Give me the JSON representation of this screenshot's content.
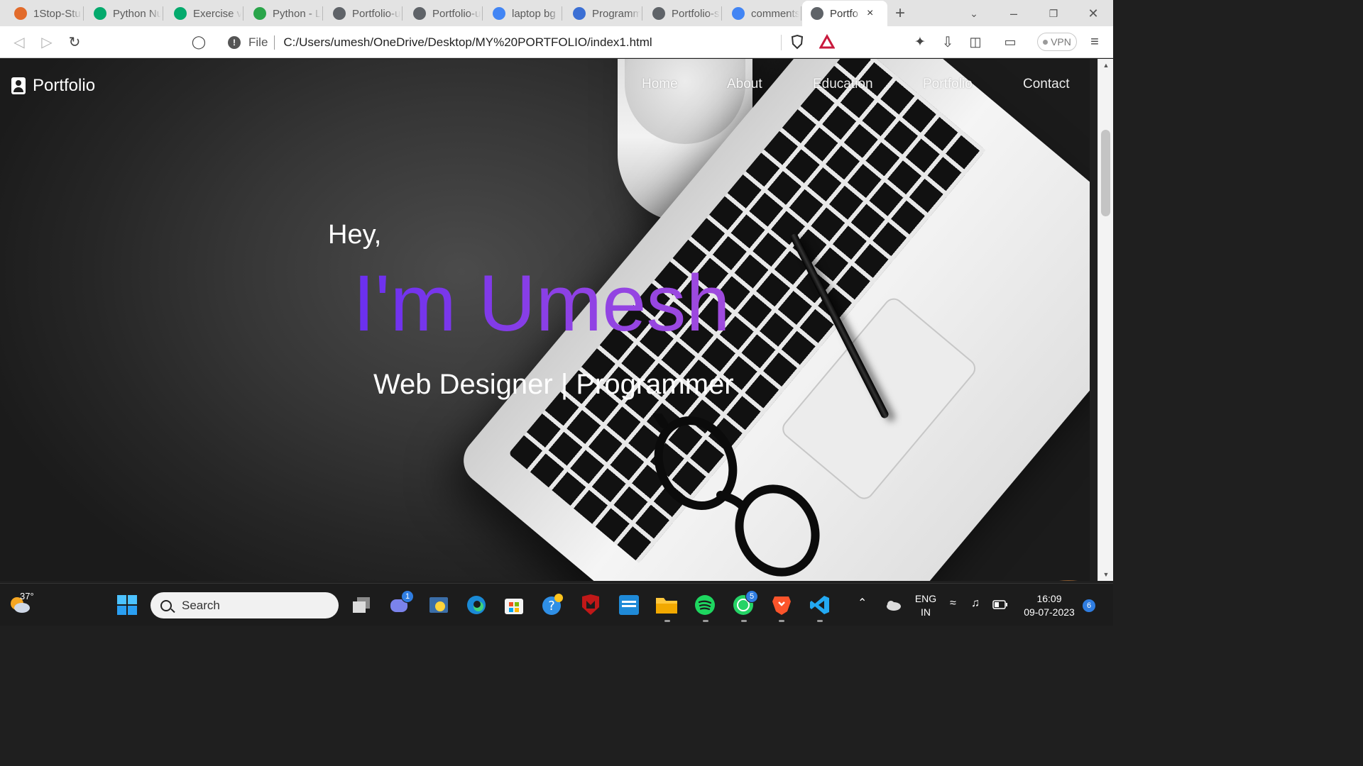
{
  "browser": {
    "tabs": [
      {
        "title": "1Stop-Stu",
        "favicon": "1stop-logo",
        "color": "#e26b2b"
      },
      {
        "title": "Python Nu",
        "favicon": "w3schools-logo",
        "color": "#04aa6d"
      },
      {
        "title": "Exercise v",
        "favicon": "w3schools-logo",
        "color": "#04aa6d"
      },
      {
        "title": "Python - L",
        "favicon": "freecodecamp-logo",
        "color": "#2aa54a"
      },
      {
        "title": "Portfolio-u",
        "favicon": "globe-icon",
        "color": "#5f6368"
      },
      {
        "title": "Portfolio-u",
        "favicon": "globe-icon",
        "color": "#5f6368"
      },
      {
        "title": "laptop bg",
        "favicon": "google-logo",
        "color": "#4285f4"
      },
      {
        "title": "Programm",
        "favicon": "programiz-logo",
        "color": "#3b6fd4"
      },
      {
        "title": "Portfolio-s",
        "favicon": "globe-icon",
        "color": "#5f6368"
      },
      {
        "title": "comments",
        "favicon": "google-logo",
        "color": "#4285f4"
      },
      {
        "title": "Portfo",
        "favicon": "globe-icon",
        "color": "#5f6368",
        "active": true
      }
    ],
    "new_tab": "+",
    "close_tab": "×",
    "address": {
      "scheme": "File",
      "url": "C:/Users/umesh/OneDrive/Desktop/MY%20PORTFOLIO/index1.html"
    },
    "vpn_label": "VPN"
  },
  "page": {
    "brand": "Portfolio",
    "nav": [
      "Home",
      "About",
      "Education",
      "Portfolio",
      "Contact"
    ],
    "greeting": "Hey,",
    "name": "I'm Umesh",
    "tagline": "Web Designer | Programmer",
    "accent_colors": [
      "#6a2ff0",
      "#a04bdd"
    ]
  },
  "taskbar": {
    "weather": "37°",
    "search_placeholder": "Search",
    "teams_badge": "1",
    "whatsapp_badge": "5",
    "language": "ENG",
    "region": "IN",
    "time": "16:09",
    "date": "09-07-2023",
    "notifications": "6"
  }
}
